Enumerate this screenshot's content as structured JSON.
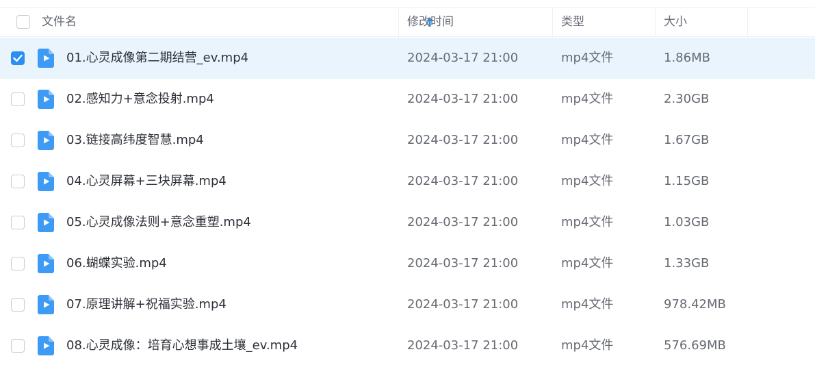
{
  "table": {
    "header": {
      "name": "文件名",
      "modified": "修改时间",
      "type": "类型",
      "size": "大小"
    },
    "sort": {
      "column": "name",
      "direction": "ascending",
      "icon": "arrow-up-icon"
    },
    "colors": {
      "accent": "#2a8ff2",
      "selected_row_bg": "#e9f4fd",
      "file_icon": "#3d9af5"
    },
    "rows": [
      {
        "name": "01.心灵成像第二期结营_ev.mp4",
        "modified": "2024-03-17 21:00",
        "type": "mp4文件",
        "size": "1.86MB",
        "selected": true
      },
      {
        "name": "02.感知力+意念投射.mp4",
        "modified": "2024-03-17 21:00",
        "type": "mp4文件",
        "size": "2.30GB",
        "selected": false
      },
      {
        "name": "03.链接高纬度智慧.mp4",
        "modified": "2024-03-17 21:00",
        "type": "mp4文件",
        "size": "1.67GB",
        "selected": false
      },
      {
        "name": "04.心灵屏幕+三块屏幕.mp4",
        "modified": "2024-03-17 21:00",
        "type": "mp4文件",
        "size": "1.15GB",
        "selected": false
      },
      {
        "name": "05.心灵成像法则+意念重塑.mp4",
        "modified": "2024-03-17 21:00",
        "type": "mp4文件",
        "size": "1.03GB",
        "selected": false
      },
      {
        "name": "06.蝴蝶实验.mp4",
        "modified": "2024-03-17 21:00",
        "type": "mp4文件",
        "size": "1.33GB",
        "selected": false
      },
      {
        "name": "07.原理讲解+祝福实验.mp4",
        "modified": "2024-03-17 21:00",
        "type": "mp4文件",
        "size": "978.42MB",
        "selected": false
      },
      {
        "name": "08.心灵成像：培育心想事成土壤_ev.mp4",
        "modified": "2024-03-17 21:00",
        "type": "mp4文件",
        "size": "576.69MB",
        "selected": false
      }
    ]
  }
}
